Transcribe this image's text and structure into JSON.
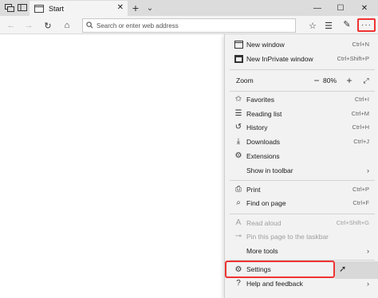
{
  "tab": {
    "title": "Start"
  },
  "address": {
    "placeholder": "Search or enter web address"
  },
  "menu": {
    "new_window": {
      "label": "New window",
      "shortcut": "Ctrl+N"
    },
    "inprivate": {
      "label": "New InPrivate window",
      "shortcut": "Ctrl+Shift+P"
    },
    "zoom": {
      "label": "Zoom",
      "value": "80%"
    },
    "favorites": {
      "label": "Favorites",
      "shortcut": "Ctrl+I"
    },
    "reading_list": {
      "label": "Reading list",
      "shortcut": "Ctrl+M"
    },
    "history": {
      "label": "History",
      "shortcut": "Ctrl+H"
    },
    "downloads": {
      "label": "Downloads",
      "shortcut": "Ctrl+J"
    },
    "extensions": {
      "label": "Extensions"
    },
    "show_toolbar": {
      "label": "Show in toolbar"
    },
    "print": {
      "label": "Print",
      "shortcut": "Ctrl+P"
    },
    "find": {
      "label": "Find on page",
      "shortcut": "Ctrl+F"
    },
    "read_aloud": {
      "label": "Read aloud",
      "shortcut": "Ctrl+Shift+G"
    },
    "pin": {
      "label": "Pin this page to the taskbar"
    },
    "more_tools": {
      "label": "More tools"
    },
    "settings": {
      "label": "Settings"
    },
    "help": {
      "label": "Help and feedback"
    }
  },
  "colors": {
    "highlight": "#e33333",
    "menu_bg": "#f2f2f2"
  },
  "icons": [
    "tab-switcher-icon",
    "set-aside-icon",
    "new-tab-icon",
    "tab-list-icon",
    "back-icon",
    "forward-icon",
    "refresh-icon",
    "home-icon",
    "search-icon",
    "favorite-star-icon",
    "favorites-hub-icon",
    "notes-icon",
    "share-icon",
    "more-icon"
  ]
}
